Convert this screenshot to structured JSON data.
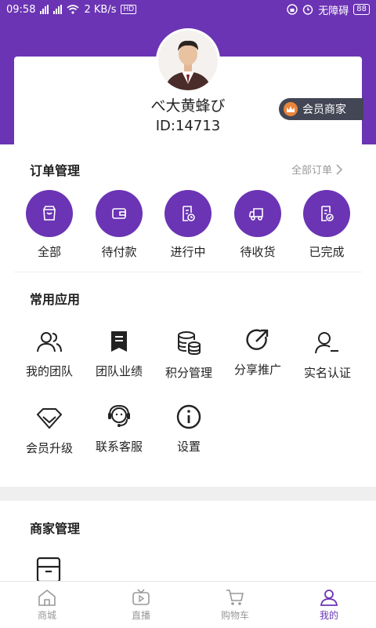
{
  "status_bar": {
    "time": "09:58",
    "network_speed": "2 KB/s",
    "accessibility": "无障碍",
    "battery": "88"
  },
  "profile": {
    "nickname": "べ大黄蜂び",
    "user_id": "ID:14713",
    "member_tag": "会员商家"
  },
  "orders": {
    "title": "订单管理",
    "all_link": "全部订单",
    "items": [
      {
        "label": "全部",
        "icon": "bag-icon"
      },
      {
        "label": "待付款",
        "icon": "wallet-icon"
      },
      {
        "label": "进行中",
        "icon": "clock-document-icon"
      },
      {
        "label": "待收货",
        "icon": "truck-icon"
      },
      {
        "label": "已完成",
        "icon": "check-document-icon"
      }
    ]
  },
  "common_apps": {
    "title": "常用应用",
    "items": [
      {
        "label": "我的团队",
        "icon": "team-icon"
      },
      {
        "label": "团队业绩",
        "icon": "bookmark-list-icon"
      },
      {
        "label": "积分管理",
        "icon": "database-icon"
      },
      {
        "label": "分享推广",
        "icon": "share-icon"
      },
      {
        "label": "实名认证",
        "icon": "user-verify-icon"
      },
      {
        "label": "会员升级",
        "icon": "diamond-icon"
      },
      {
        "label": "联系客服",
        "icon": "headset-icon"
      },
      {
        "label": "设置",
        "icon": "info-icon"
      }
    ]
  },
  "merchant": {
    "title": "商家管理"
  },
  "tabbar": {
    "items": [
      {
        "label": "商城",
        "icon": "home-icon"
      },
      {
        "label": "直播",
        "icon": "live-icon"
      },
      {
        "label": "购物车",
        "icon": "cart-icon"
      },
      {
        "label": "我的",
        "icon": "user-icon",
        "active": true
      }
    ]
  },
  "colors": {
    "brand": "#6b34b4",
    "member_tag_bg": "#434654",
    "badge": "#e9853a"
  }
}
